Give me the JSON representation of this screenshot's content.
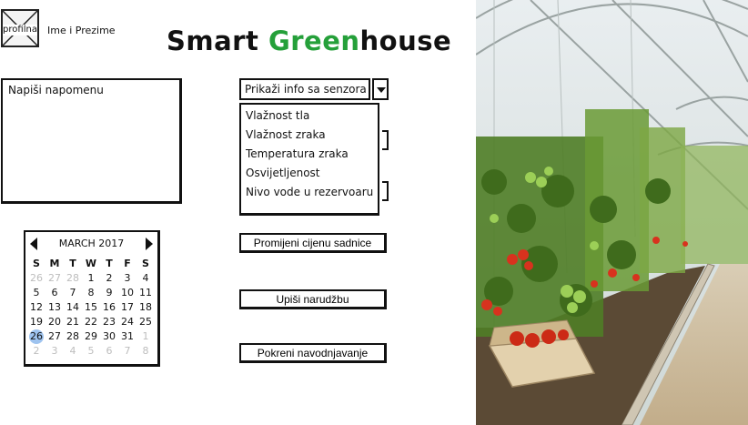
{
  "profile": {
    "avatar_label": "profilna",
    "name": "Ime i Prezime"
  },
  "title": {
    "part1": "Smart ",
    "part2": "Green",
    "part3": "house",
    "accent_color": "#25a03a"
  },
  "note": {
    "placeholder": "Napiši napomenu"
  },
  "calendar": {
    "month": "MARCH 2017",
    "weekdays": [
      "S",
      "M",
      "T",
      "W",
      "T",
      "F",
      "S"
    ],
    "weeks": [
      [
        {
          "d": "26",
          "dim": true
        },
        {
          "d": "27",
          "dim": true
        },
        {
          "d": "28",
          "dim": true
        },
        {
          "d": "1"
        },
        {
          "d": "2"
        },
        {
          "d": "3"
        },
        {
          "d": "4"
        }
      ],
      [
        {
          "d": "5"
        },
        {
          "d": "6"
        },
        {
          "d": "7"
        },
        {
          "d": "8"
        },
        {
          "d": "9"
        },
        {
          "d": "10"
        },
        {
          "d": "11"
        }
      ],
      [
        {
          "d": "12"
        },
        {
          "d": "13"
        },
        {
          "d": "14"
        },
        {
          "d": "15"
        },
        {
          "d": "16"
        },
        {
          "d": "17"
        },
        {
          "d": "18"
        }
      ],
      [
        {
          "d": "19"
        },
        {
          "d": "20"
        },
        {
          "d": "21"
        },
        {
          "d": "22"
        },
        {
          "d": "23"
        },
        {
          "d": "24"
        },
        {
          "d": "25"
        }
      ],
      [
        {
          "d": "26",
          "selected": true
        },
        {
          "d": "27"
        },
        {
          "d": "28"
        },
        {
          "d": "29"
        },
        {
          "d": "30"
        },
        {
          "d": "31"
        },
        {
          "d": "1",
          "dim": true
        }
      ],
      [
        {
          "d": "2",
          "dim": true
        },
        {
          "d": "3",
          "dim": true
        },
        {
          "d": "4",
          "dim": true
        },
        {
          "d": "5",
          "dim": true
        },
        {
          "d": "6",
          "dim": true
        },
        {
          "d": "7",
          "dim": true
        },
        {
          "d": "8",
          "dim": true
        }
      ]
    ],
    "selected_color": "#9ec3ef"
  },
  "sensors": {
    "selected": "Prikaži info sa senzora",
    "options": [
      "Vlažnost tla",
      "Vlažnost zraka",
      "Temperatura zraka",
      "Osvijetljenost",
      "Nivo vode u rezervoaru"
    ]
  },
  "buttons": {
    "price": "Promijeni cijenu sadnice",
    "order": "Upiši narudžbu",
    "irrigation": "Pokreni navodnjavanje"
  },
  "icons": {
    "dropdown": "chevron-down-icon",
    "prev": "arrow-left-icon",
    "next": "arrow-right-icon",
    "avatar": "image-placeholder-icon"
  }
}
